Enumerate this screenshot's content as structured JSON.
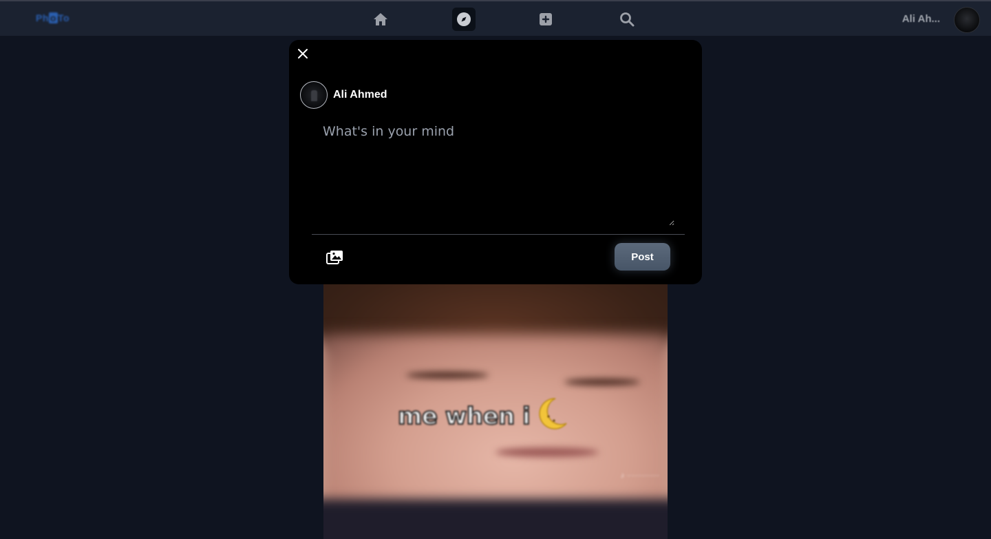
{
  "navbar": {
    "logo_text": "PhotTo",
    "nav_items": [
      "home",
      "explore",
      "create",
      "search"
    ],
    "user_name_truncated": "Ali Ah..."
  },
  "modal": {
    "author_name": "Ali Ahmed",
    "textarea_placeholder": "What's in your mind",
    "post_button_label": "Post"
  },
  "feed": {
    "image_caption": "me when i"
  },
  "colors": {
    "page_bg": "#0f1420",
    "navbar_bg": "#1b2230",
    "modal_bg": "#000000",
    "post_button": "#4f5d70",
    "logo": "#2a5fb0"
  }
}
